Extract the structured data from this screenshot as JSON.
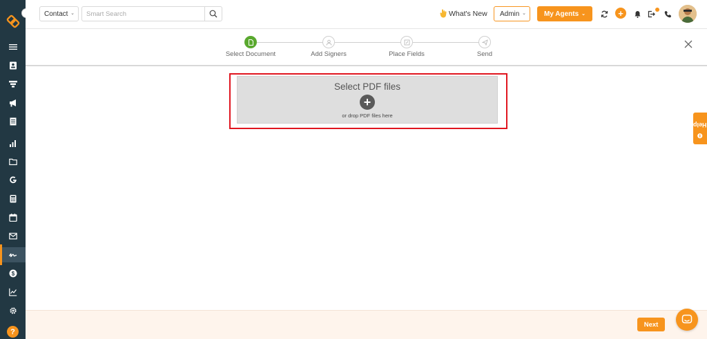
{
  "sidebar": {
    "items": [
      {
        "icon": "list-icon"
      },
      {
        "icon": "contact-card-icon"
      },
      {
        "icon": "funnel-icon"
      },
      {
        "icon": "megaphone-icon"
      },
      {
        "icon": "document-icon"
      },
      {
        "icon": "bar-chart-icon"
      },
      {
        "icon": "folder-icon"
      },
      {
        "icon": "google-icon"
      },
      {
        "icon": "calculator-icon"
      },
      {
        "icon": "calendar-icon"
      },
      {
        "icon": "mail-icon"
      },
      {
        "icon": "signature-icon",
        "active": true
      },
      {
        "icon": "dollar-icon"
      },
      {
        "icon": "line-chart-icon"
      },
      {
        "icon": "settings-icon"
      }
    ],
    "help_label": "?"
  },
  "topbar": {
    "contact_select": "Contact",
    "search_placeholder": "Smart Search",
    "whats_new": "What's New",
    "admin_select": "Admin",
    "agents_label": "My Agents"
  },
  "stepper": {
    "steps": [
      {
        "label": "Select Document",
        "active": true
      },
      {
        "label": "Add Signers",
        "active": false
      },
      {
        "label": "Place Fields",
        "active": false
      },
      {
        "label": "Send",
        "active": false
      }
    ]
  },
  "dropzone": {
    "title": "Select PDF files",
    "hint": "or drop PDF files here"
  },
  "help_tab": "Help",
  "footer": {
    "next_label": "Next"
  },
  "colors": {
    "accent": "#f7941d",
    "sidebar": "#223843",
    "step_active": "#5aa92f",
    "highlight": "#e0141e"
  }
}
